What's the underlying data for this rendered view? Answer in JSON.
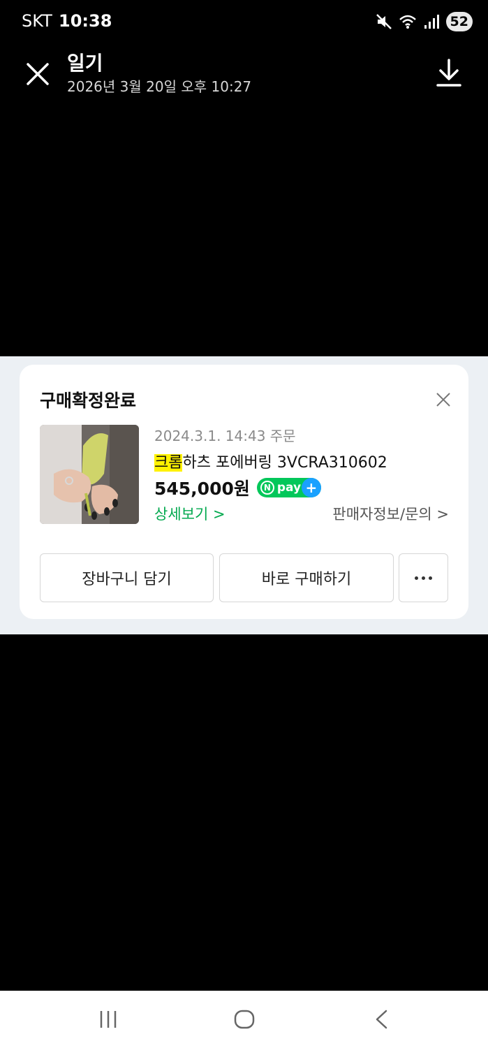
{
  "status_bar": {
    "carrier": "SKT",
    "time": "10:38",
    "battery": "52",
    "icons": [
      "mute-icon",
      "wifi-icon",
      "signal-icon"
    ]
  },
  "header": {
    "title": "일기",
    "subtitle": "2026년 3월 20일 오후 10:27",
    "close_icon": "close-icon",
    "download_icon": "download-icon"
  },
  "card": {
    "title": "구매확정완료",
    "order_date": "2024.3.1. 14:43 주문",
    "product_name_highlight": "크롬",
    "product_name_rest": "하츠 포에버링 3VCRA310602",
    "price": "545,000원",
    "pay_badge": {
      "n": "N",
      "text": "pay",
      "plus": "+"
    },
    "detail_link": "상세보기 >",
    "seller_link": "판매자정보/문의 >",
    "buttons": {
      "cart": "장바구니 담기",
      "buy": "바로 구매하기"
    }
  },
  "nav_bar": {
    "icons": [
      "recent-apps-icon",
      "home-icon",
      "back-icon"
    ]
  },
  "colors": {
    "accent_green": "#03c75a",
    "link_green": "#03a94f",
    "highlight_yellow": "#fff200",
    "npay_blue": "#1aa1ff"
  }
}
